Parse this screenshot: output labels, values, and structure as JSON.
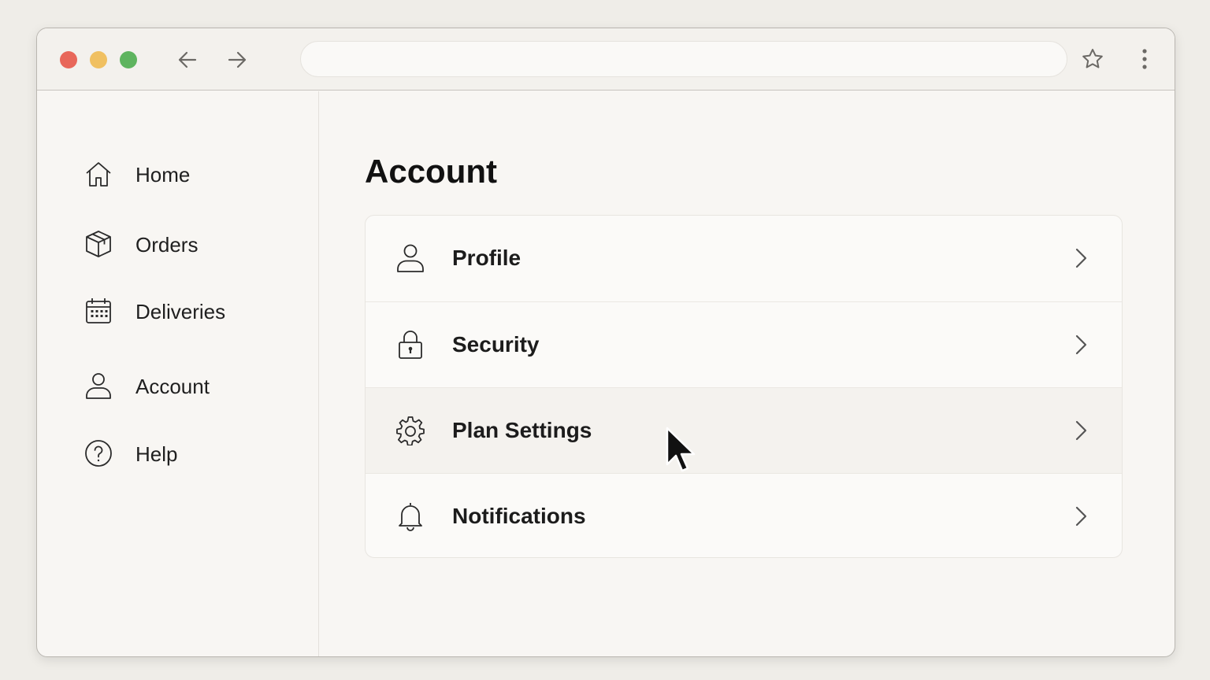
{
  "browser": {
    "url": "",
    "traffic_lights": {
      "close": "#e8675a",
      "minimize": "#f0c061",
      "maximize": "#5eb45f"
    }
  },
  "sidebar": {
    "items": [
      {
        "label": "Home",
        "icon": "home-icon"
      },
      {
        "label": "Orders",
        "icon": "box-icon"
      },
      {
        "label": "Deliveries",
        "icon": "calendar-icon"
      },
      {
        "label": "Account",
        "icon": "user-icon"
      },
      {
        "label": "Help",
        "icon": "help-circle-icon"
      }
    ]
  },
  "main": {
    "title": "Account",
    "rows": [
      {
        "label": "Profile",
        "icon": "user-icon"
      },
      {
        "label": "Security",
        "icon": "lock-icon"
      },
      {
        "label": "Plan Settings",
        "icon": "gear-icon",
        "hovered": true
      },
      {
        "label": "Notifications",
        "icon": "bell-icon"
      }
    ]
  }
}
